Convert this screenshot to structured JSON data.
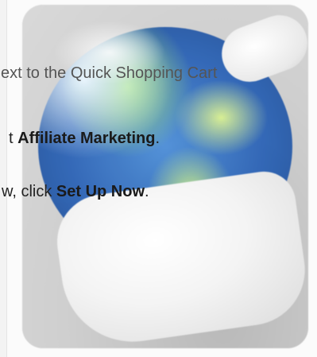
{
  "instructions": {
    "line1": "ext to the Quick Shopping Cart",
    "line2_prefix": "t ",
    "line2_bold": "Affiliate Marketing",
    "line2_suffix": ".",
    "line3_prefix": "w, click ",
    "line3_bold": "Set Up Now",
    "line3_suffix": "."
  },
  "image": {
    "icon": "globe-in-hand-icon"
  }
}
